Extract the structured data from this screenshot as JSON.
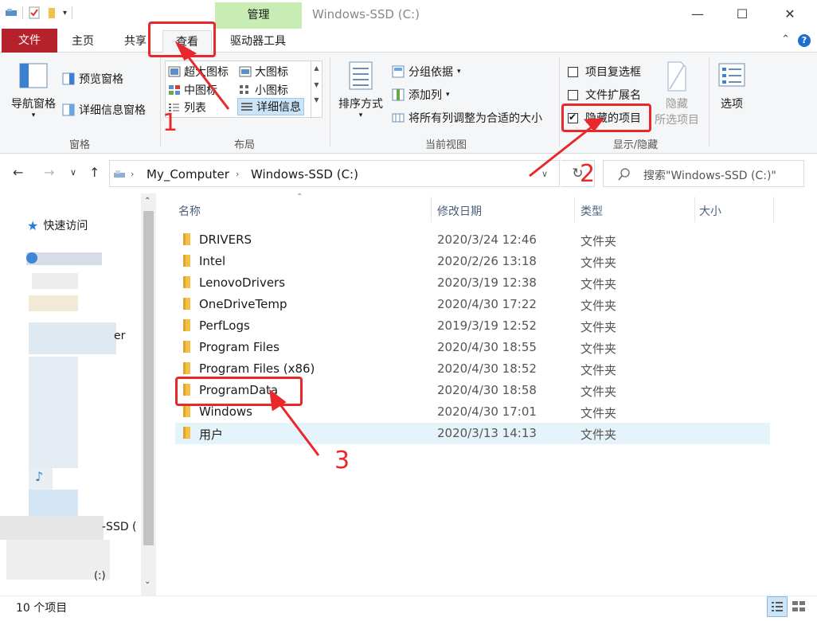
{
  "window": {
    "title": "Windows-SSD (C:)",
    "context_tab": "管理"
  },
  "ribbon_tabs": {
    "file": "文件",
    "home": "主页",
    "share": "共享",
    "view": "查看",
    "drive_tools": "驱动器工具"
  },
  "ribbon": {
    "pane_group": {
      "nav_pane": "导航窗格",
      "preview_pane": "预览窗格",
      "details_pane": "详细信息窗格",
      "label": "窗格"
    },
    "layout_group": {
      "extra_large": "超大图标",
      "large": "大图标",
      "medium": "中图标",
      "small": "小图标",
      "list": "列表",
      "details": "详细信息",
      "label": "布局"
    },
    "view_group": {
      "sort": "排序方式",
      "group_by": "分组依据",
      "add_column": "添加列",
      "fit_columns": "将所有列调整为合适的大小",
      "label": "当前视图"
    },
    "show_hide_group": {
      "item_checkboxes": "项目复选框",
      "file_ext": "文件扩展名",
      "hidden_items": "隐藏的项目",
      "hide_line1": "隐藏",
      "hide_line2": "所选项目",
      "label": "显示/隐藏"
    },
    "options": "选项"
  },
  "address": {
    "root": "My_Computer",
    "drive": "Windows-SSD (C:)",
    "search_placeholder": "搜索\"Windows-SSD (C:)\""
  },
  "nav": {
    "quick_access": "快速访问",
    "partial_1": "er",
    "partial_2": "-SSD (",
    "partial_3": "(:)"
  },
  "columns": {
    "name": "名称",
    "modified": "修改日期",
    "type": "类型",
    "size": "大小"
  },
  "files": [
    {
      "name": "DRIVERS",
      "date": "2020/3/24 12:46",
      "type": "文件夹"
    },
    {
      "name": "Intel",
      "date": "2020/2/26 13:18",
      "type": "文件夹"
    },
    {
      "name": "LenovoDrivers",
      "date": "2020/3/19 12:38",
      "type": "文件夹"
    },
    {
      "name": "OneDriveTemp",
      "date": "2020/4/30 17:22",
      "type": "文件夹"
    },
    {
      "name": "PerfLogs",
      "date": "2019/3/19 12:52",
      "type": "文件夹"
    },
    {
      "name": "Program Files",
      "date": "2020/4/30 18:55",
      "type": "文件夹"
    },
    {
      "name": "Program Files (x86)",
      "date": "2020/4/30 18:52",
      "type": "文件夹"
    },
    {
      "name": "ProgramData",
      "date": "2020/4/30 18:58",
      "type": "文件夹"
    },
    {
      "name": "Windows",
      "date": "2020/4/30 17:01",
      "type": "文件夹"
    },
    {
      "name": "用户",
      "date": "2020/3/13 14:13",
      "type": "文件夹"
    }
  ],
  "status": {
    "count": "10 个项目"
  },
  "annotations": {
    "one": "1",
    "two": "2",
    "three": "3"
  },
  "colors": {
    "accent_red": "#e8282a",
    "file_tab": "#b5222b",
    "context_tab": "#c7ecb4",
    "selection": "#e5f3fb",
    "folder": "#f3c04a"
  }
}
